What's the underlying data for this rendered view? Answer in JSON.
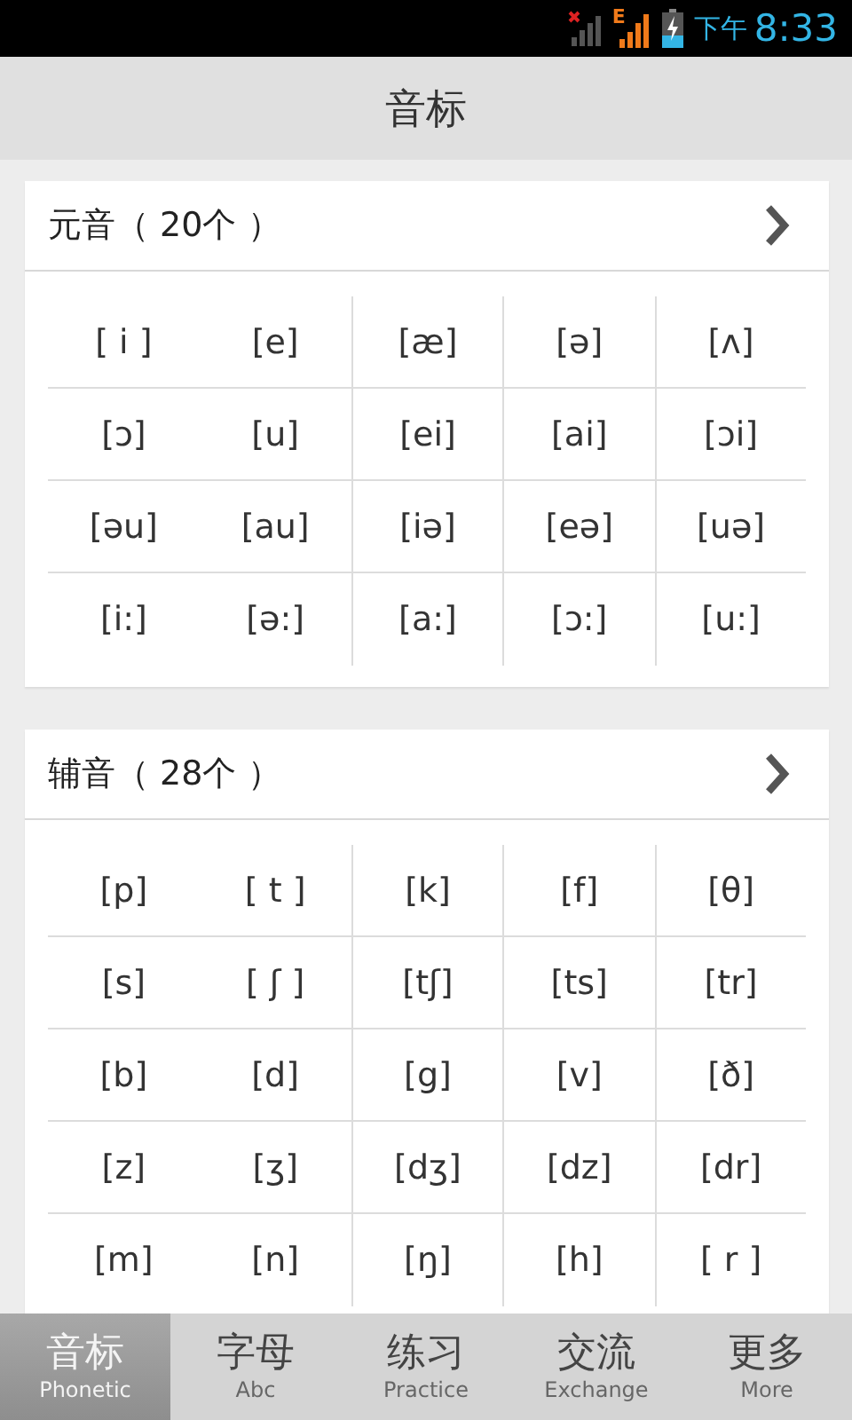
{
  "status_bar": {
    "network_type": "E",
    "time_period": "下午",
    "time": "8:33"
  },
  "title": "音标",
  "sections": [
    {
      "title": "元音（ 20个 ）",
      "items": [
        "[ i ]",
        "[e]",
        "[æ]",
        "[ə]",
        "[ʌ]",
        "[ɔ]",
        "[u]",
        "[ei]",
        "[ai]",
        "[ɔi]",
        "[əu]",
        "[au]",
        "[iə]",
        "[eə]",
        "[uə]",
        "[i:]",
        "[ə:]",
        "[a:]",
        "[ɔ:]",
        "[u:]"
      ]
    },
    {
      "title": "辅音（ 28个 ）",
      "items": [
        "[p]",
        "[ t ]",
        "[k]",
        "[f]",
        "[θ]",
        "[s]",
        "[ ʃ ]",
        "[tʃ]",
        "[ts]",
        "[tr]",
        "[b]",
        "[d]",
        "[g]",
        "[v]",
        "[ð]",
        "[z]",
        "[ʒ]",
        "[dʒ]",
        "[dz]",
        "[dr]",
        "[m]",
        "[n]",
        "[ŋ]",
        "[h]",
        "[ r ]"
      ]
    }
  ],
  "tabs": [
    {
      "label": "音标",
      "sublabel": "Phonetic",
      "selected": true
    },
    {
      "label": "字母",
      "sublabel": "Abc",
      "selected": false
    },
    {
      "label": "练习",
      "sublabel": "Practice",
      "selected": false
    },
    {
      "label": "交流",
      "sublabel": "Exchange",
      "selected": false
    },
    {
      "label": "更多",
      "sublabel": "More",
      "selected": false
    }
  ]
}
